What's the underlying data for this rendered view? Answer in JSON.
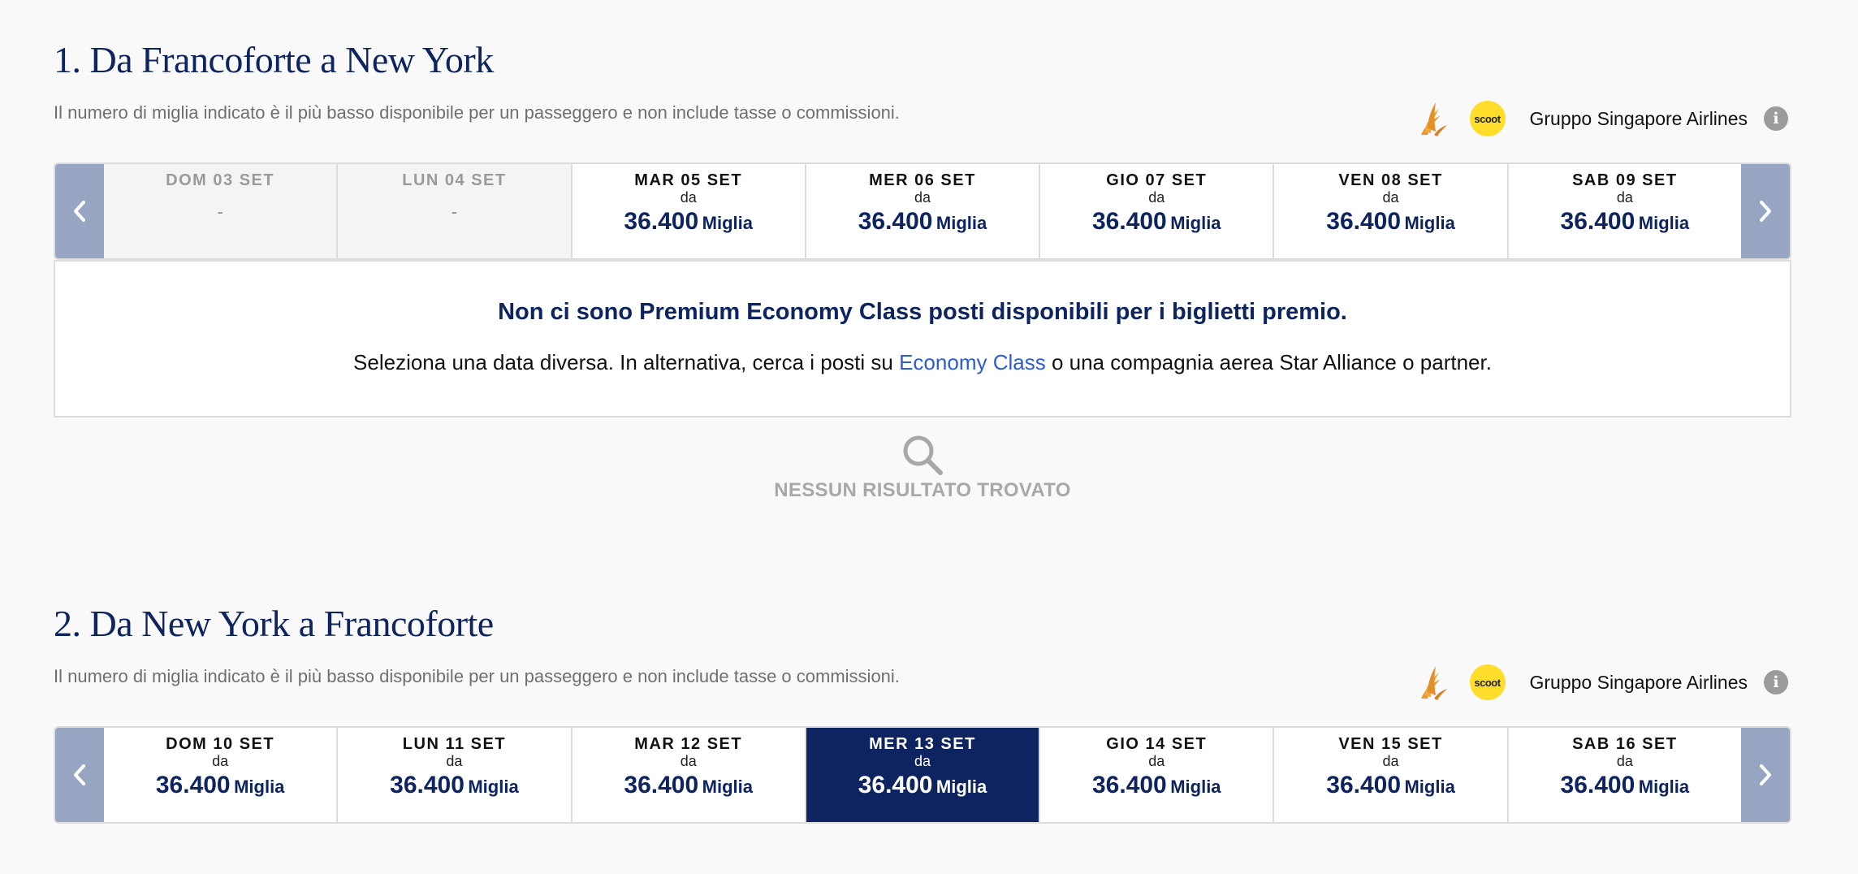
{
  "colors": {
    "navy": "#0d2461",
    "arrow_bg": "#98a5c2",
    "link": "#2b5bd7",
    "scoot_yellow": "#ffdd2b",
    "sia_orange": "#e79a2b"
  },
  "section1": {
    "title": "1. Da Francoforte a New York",
    "note": "Il numero di miglia indicato è il più basso disponibile per un passeggero e non include tasse o commissioni.",
    "airline_group": "Gruppo Singapore Airlines",
    "scoot_logo": "scoot",
    "info_icon": "i",
    "dates": [
      {
        "label": "DOM 03 SET",
        "available": false,
        "dash": "-"
      },
      {
        "label": "LUN 04 SET",
        "available": false,
        "dash": "-"
      },
      {
        "label": "MAR 05 SET",
        "available": true,
        "from": "da",
        "price": "36.400",
        "unit": "Miglia"
      },
      {
        "label": "MER 06 SET",
        "available": true,
        "from": "da",
        "price": "36.400",
        "unit": "Miglia"
      },
      {
        "label": "GIO 07 SET",
        "available": true,
        "from": "da",
        "price": "36.400",
        "unit": "Miglia"
      },
      {
        "label": "VEN 08 SET",
        "available": true,
        "from": "da",
        "price": "36.400",
        "unit": "Miglia"
      },
      {
        "label": "SAB 09 SET",
        "available": true,
        "from": "da",
        "price": "36.400",
        "unit": "Miglia"
      }
    ],
    "message": {
      "title": "Non ci sono Premium Economy Class posti disponibili per i biglietti premio.",
      "body_before": "Seleziona una data diversa. In alternativa, cerca i posti su ",
      "body_link": "Economy Class",
      "body_after": " o una compagnia aerea Star Alliance o partner."
    },
    "no_results": "NESSUN RISULTATO TROVATO"
  },
  "section2": {
    "title": "2. Da New York a Francoforte",
    "note": "Il numero di miglia indicato è il più basso disponibile per un passeggero e non include tasse o commissioni.",
    "airline_group": "Gruppo Singapore Airlines",
    "scoot_logo": "scoot",
    "info_icon": "i",
    "dates": [
      {
        "label": "DOM 10 SET",
        "from": "da",
        "price": "36.400",
        "unit": "Miglia"
      },
      {
        "label": "LUN 11 SET",
        "from": "da",
        "price": "36.400",
        "unit": "Miglia"
      },
      {
        "label": "MAR 12 SET",
        "from": "da",
        "price": "36.400",
        "unit": "Miglia"
      },
      {
        "label": "MER 13 SET",
        "from": "da",
        "price": "36.400",
        "unit": "Miglia",
        "selected": true
      },
      {
        "label": "GIO 14 SET",
        "from": "da",
        "price": "36.400",
        "unit": "Miglia"
      },
      {
        "label": "VEN 15 SET",
        "from": "da",
        "price": "36.400",
        "unit": "Miglia"
      },
      {
        "label": "SAB 16 SET",
        "from": "da",
        "price": "36.400",
        "unit": "Miglia"
      }
    ]
  }
}
